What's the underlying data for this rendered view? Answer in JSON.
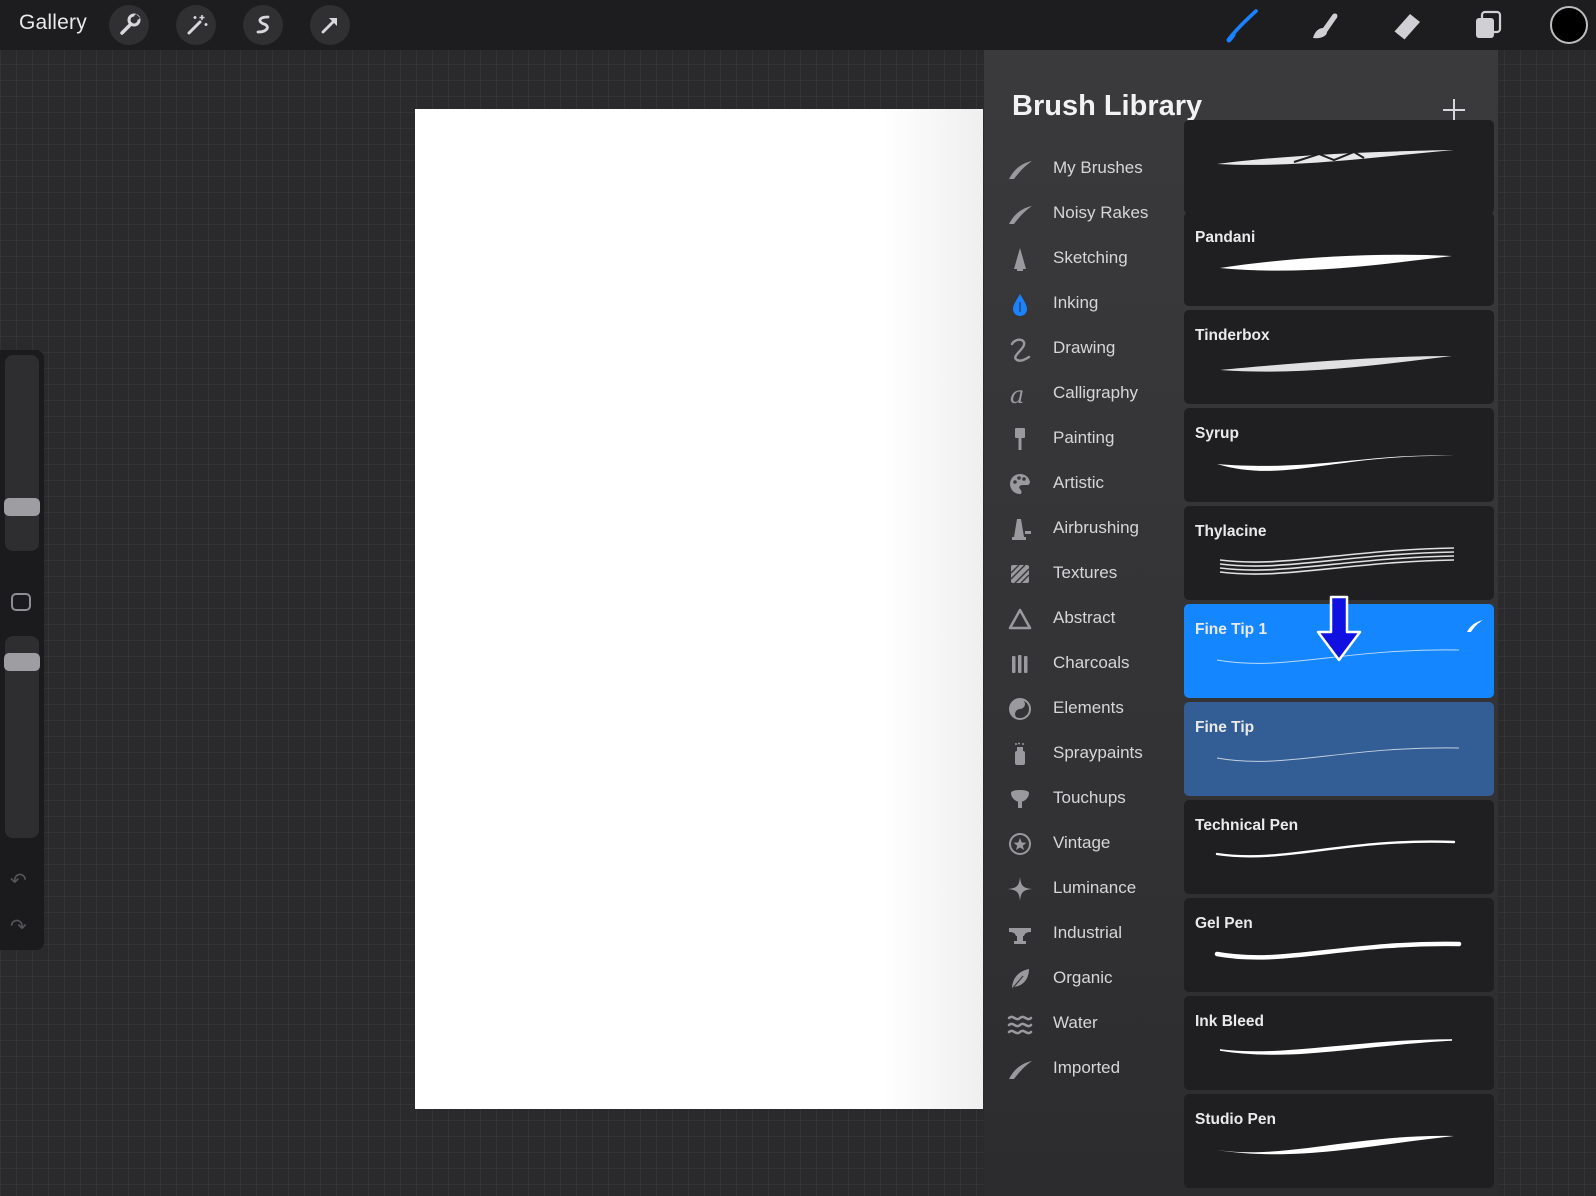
{
  "toolbar": {
    "gallery_label": "Gallery",
    "left_tools": [
      "wrench-icon",
      "magic-wand-icon",
      "selection-icon",
      "transform-arrow-icon"
    ],
    "right_tools": [
      "brush-icon",
      "smudge-icon",
      "eraser-icon",
      "layers-icon"
    ],
    "active_tool": "brush",
    "current_color": "#000000",
    "accent": "#1a82ff"
  },
  "brush_library": {
    "title": "Brush Library",
    "categories": [
      {
        "label": "My Brushes",
        "icon": "feather-stroke-icon"
      },
      {
        "label": "Noisy Rakes",
        "icon": "feather-stroke-icon"
      },
      {
        "label": "Sketching",
        "icon": "pencil-tip-icon"
      },
      {
        "label": "Inking",
        "icon": "ink-drop-icon",
        "selected": true
      },
      {
        "label": "Drawing",
        "icon": "squiggle-icon"
      },
      {
        "label": "Calligraphy",
        "icon": "script-a-icon"
      },
      {
        "label": "Painting",
        "icon": "paintbrush-icon"
      },
      {
        "label": "Artistic",
        "icon": "palette-icon"
      },
      {
        "label": "Airbrushing",
        "icon": "airbrush-icon"
      },
      {
        "label": "Textures",
        "icon": "texture-icon"
      },
      {
        "label": "Abstract",
        "icon": "triangle-icon"
      },
      {
        "label": "Charcoals",
        "icon": "charcoal-sticks-icon"
      },
      {
        "label": "Elements",
        "icon": "yin-yang-icon"
      },
      {
        "label": "Spraypaints",
        "icon": "spray-can-icon"
      },
      {
        "label": "Touchups",
        "icon": "touchup-icon"
      },
      {
        "label": "Vintage",
        "icon": "star-badge-icon"
      },
      {
        "label": "Luminance",
        "icon": "sparkle-icon"
      },
      {
        "label": "Industrial",
        "icon": "anvil-icon"
      },
      {
        "label": "Organic",
        "icon": "leaf-icon"
      },
      {
        "label": "Water",
        "icon": "waves-icon"
      },
      {
        "label": "Imported",
        "icon": "feather-stroke-icon"
      }
    ],
    "brushes": [
      {
        "name": "",
        "style": "rough"
      },
      {
        "name": "Pandani",
        "style": "thick-rough"
      },
      {
        "name": "Tinderbox",
        "style": "grainy"
      },
      {
        "name": "Syrup",
        "style": "smooth-thick"
      },
      {
        "name": "Thylacine",
        "style": "multi-line"
      },
      {
        "name": "Fine Tip 1",
        "style": "hairline",
        "selected": "primary",
        "badge": "feather-stroke-icon"
      },
      {
        "name": "Fine Tip",
        "style": "hairline",
        "selected": "secondary"
      },
      {
        "name": "Technical Pen",
        "style": "thin"
      },
      {
        "name": "Gel Pen",
        "style": "round"
      },
      {
        "name": "Ink Bleed",
        "style": "bleed"
      },
      {
        "name": "Studio Pen",
        "style": "tapered"
      }
    ]
  }
}
